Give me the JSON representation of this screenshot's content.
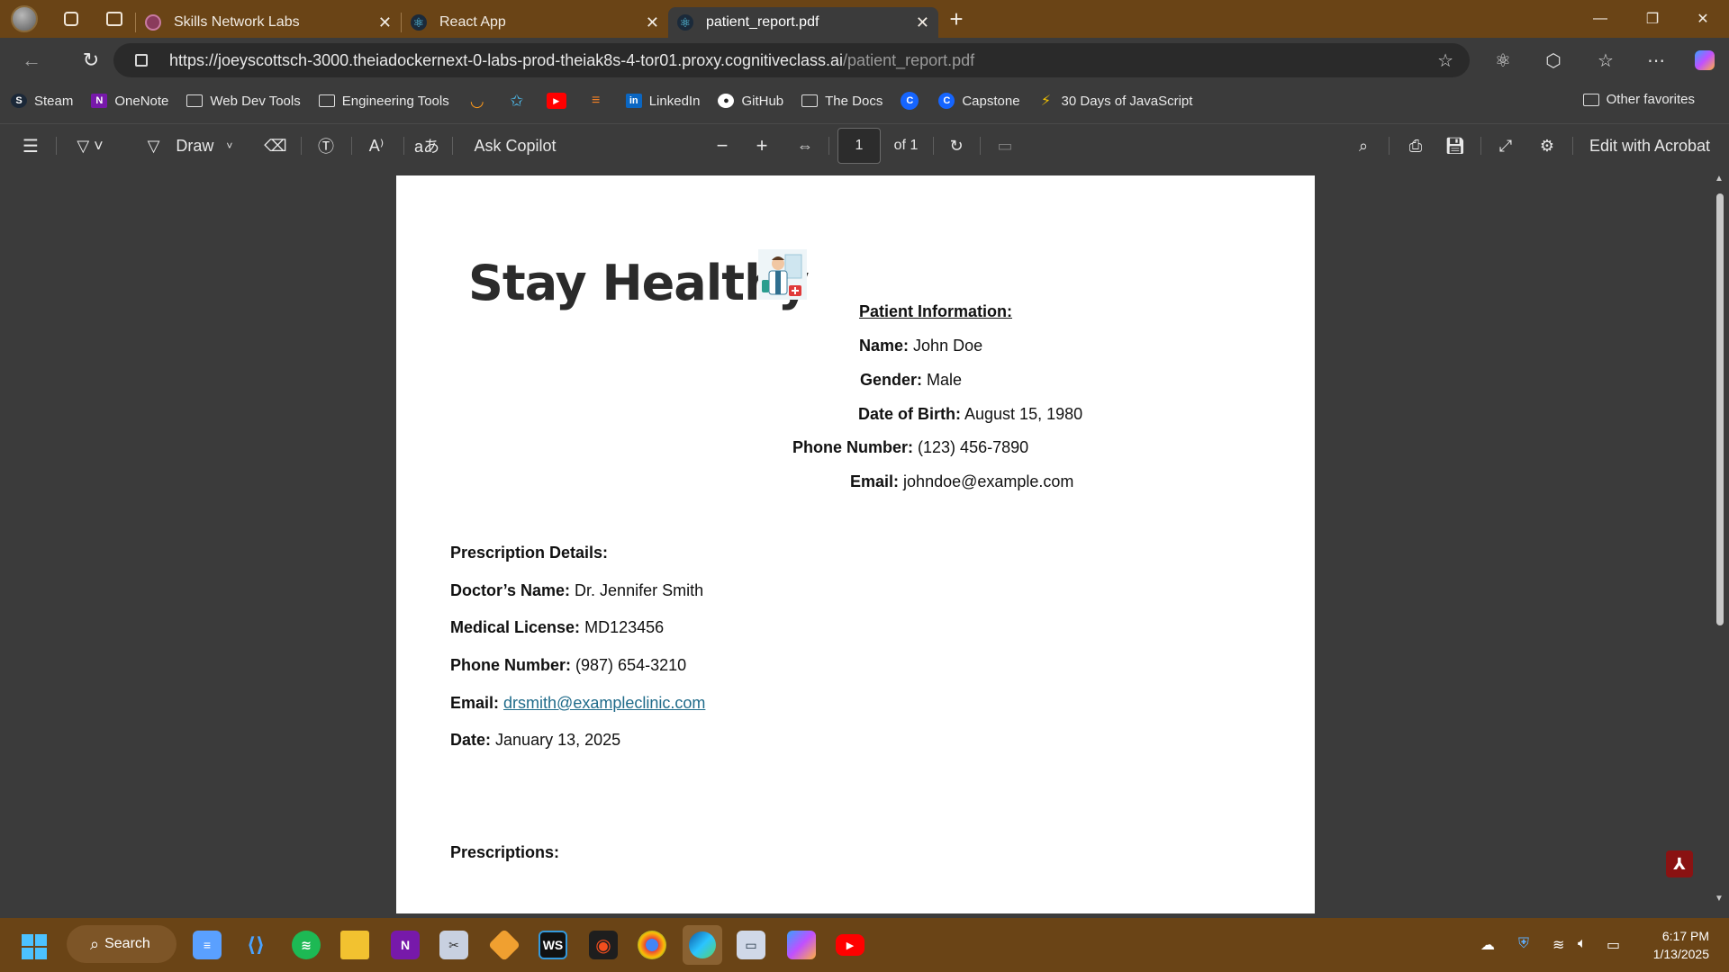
{
  "browser": {
    "tabs": [
      {
        "title": "Skills Network Labs",
        "active": false
      },
      {
        "title": "React App",
        "active": false
      },
      {
        "title": "patient_report.pdf",
        "active": true
      }
    ],
    "url_host": "https://joeyscottsch-3000.theiadockernext-0-labs-prod-theiak8s-4-tor01.proxy.cognitiveclass.ai",
    "url_path": "/patient_report.pdf",
    "bookmarks": [
      "Steam",
      "OneNote",
      "Web Dev Tools",
      "Engineering Tools",
      "LinkedIn",
      "GitHub",
      "The Docs",
      "Capstone",
      "30 Days of JavaScript"
    ],
    "other_favorites": "Other favorites"
  },
  "pdf_toolbar": {
    "draw_label": "Draw",
    "ask_copilot": "Ask Copilot",
    "page_current": "1",
    "page_total": "of 1",
    "edit_acrobat": "Edit with Acrobat"
  },
  "document": {
    "title": "Stay Healthy",
    "patient": {
      "heading": "Patient Information:",
      "name_label": "Name:",
      "name": "John Doe",
      "gender_label": "Gender:",
      "gender": "Male",
      "dob_label": "Date of Birth:",
      "dob": "August 15, 1980",
      "phone_label": "Phone Number:",
      "phone": "(123) 456-7890",
      "email_label": "Email:",
      "email": "johndoe@example.com"
    },
    "prescription": {
      "heading": "Prescription Details:",
      "doctor_label": "Doctor’s Name:",
      "doctor": "Dr. Jennifer Smith",
      "license_label": "Medical License:",
      "license": "MD123456",
      "phone_label": "Phone Number:",
      "phone": "(987) 654-3210",
      "email_label": "Email:",
      "email": "drsmith@exampleclinic.com",
      "date_label": "Date:",
      "date": "January 13, 2025"
    },
    "prescriptions_heading": "Prescriptions:"
  },
  "taskbar": {
    "search_label": "Search",
    "time": "6:17 PM",
    "date": "1/13/2025"
  },
  "colors": {
    "tabstrip": "#6a4416",
    "chrome": "#3b3b3b",
    "link": "#1f6b8a"
  }
}
